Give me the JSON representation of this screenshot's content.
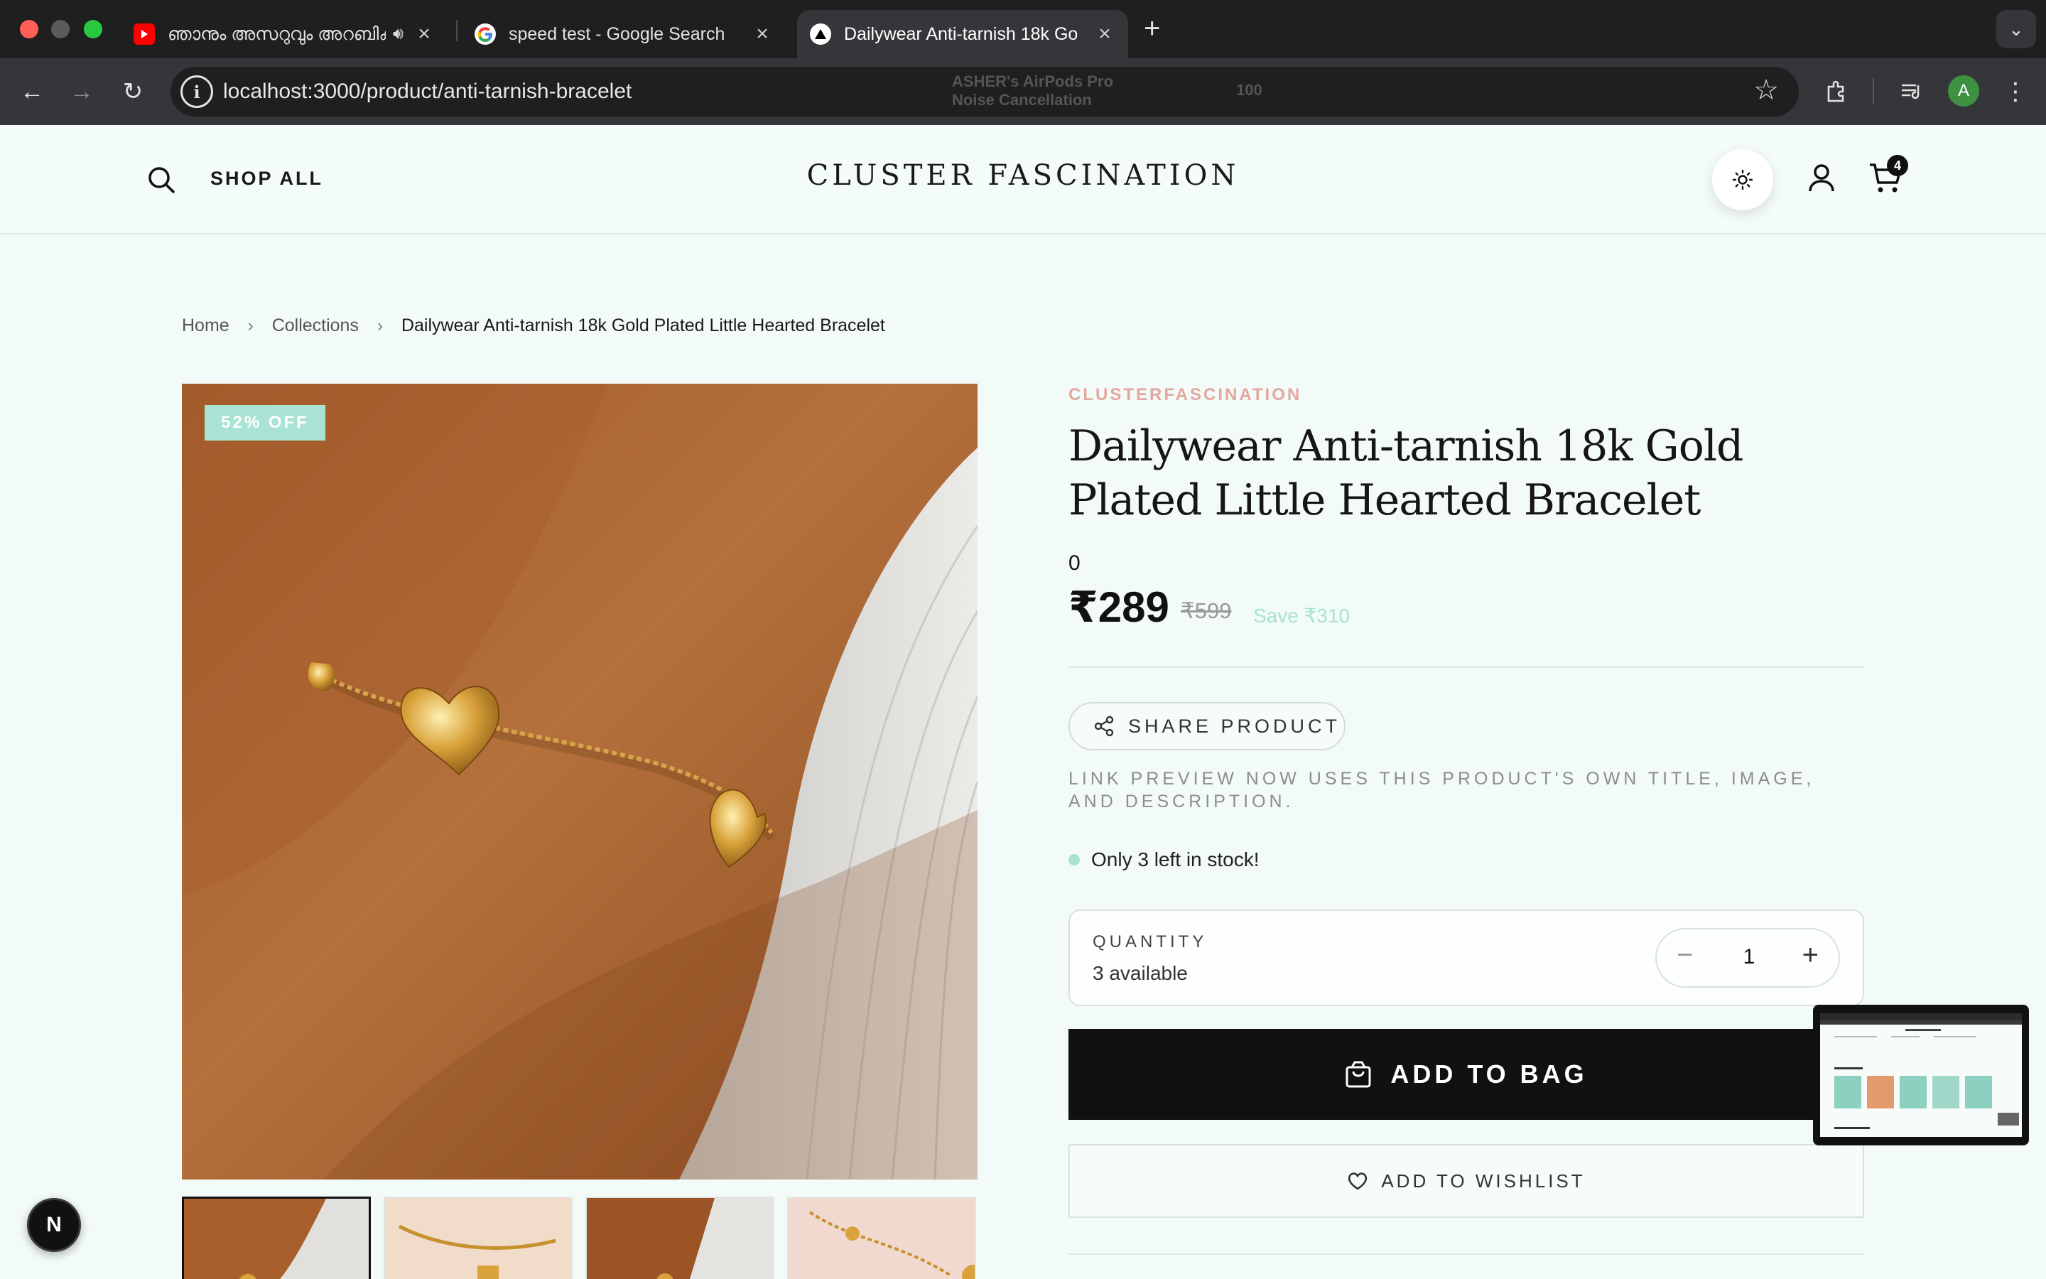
{
  "browser": {
    "tabs": [
      {
        "title": "ഞാനും അസറുവും അറബിക്",
        "favicon": "youtube-icon",
        "audio": true
      },
      {
        "title": "speed test - Google Search",
        "favicon": "google-icon"
      },
      {
        "title": "Dailywear Anti-tarnish 18k Go",
        "favicon": "vercel-icon",
        "active": true
      }
    ],
    "url": "localhost:3000/product/anti-tarnish-bracelet",
    "ghost_text_line1": "ASHER's AirPods Pro",
    "ghost_text_line2": "Noise Cancellation",
    "ghost_level": "100",
    "profile_initial": "A"
  },
  "header": {
    "shop_all": "SHOP ALL",
    "brand": "CLUSTER FASCINATION",
    "cart_count": "4"
  },
  "breadcrumb": {
    "home": "Home",
    "collections": "Collections",
    "current": "Dailywear Anti-tarnish 18k Gold Plated Little Hearted Bracelet"
  },
  "product": {
    "discount_badge": "52% OFF",
    "vendor": "CLUSTERFASCINATION",
    "title": "Dailywear Anti-tarnish 18k Gold Plated Little Hearted Bracelet",
    "zero_text": "0",
    "price": "₹289",
    "compare_price": "₹599",
    "save_text": "Save ₹310",
    "share_label": "SHARE PRODUCT",
    "share_note": "LINK PREVIEW NOW USES THIS PRODUCT'S OWN TITLE, IMAGE, AND DESCRIPTION.",
    "stock_text": "Only 3 left in stock!",
    "quantity_label": "QUANTITY",
    "available_text": "3 available",
    "quantity_value": "1",
    "add_to_bag": "ADD TO BAG",
    "add_to_wishlist": "ADD TO WISHLIST"
  },
  "misc": {
    "next_badge": "N"
  },
  "colors": {
    "accent_mint": "#a6e3d0",
    "vendor_pink": "#e2a79e",
    "button_black": "#111111",
    "background": "#f3fbf8"
  }
}
